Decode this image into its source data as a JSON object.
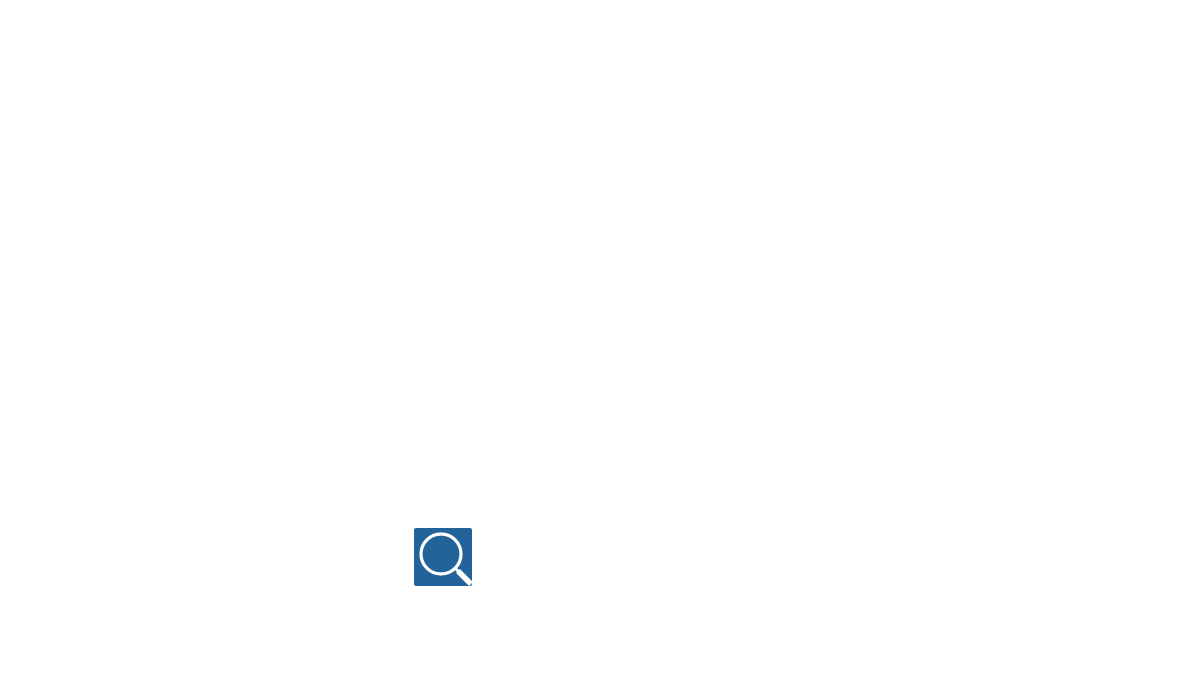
{
  "search_button": {
    "icon": "search-icon",
    "label": "Search",
    "background_color": "#22649a",
    "icon_color": "#ffffff"
  }
}
